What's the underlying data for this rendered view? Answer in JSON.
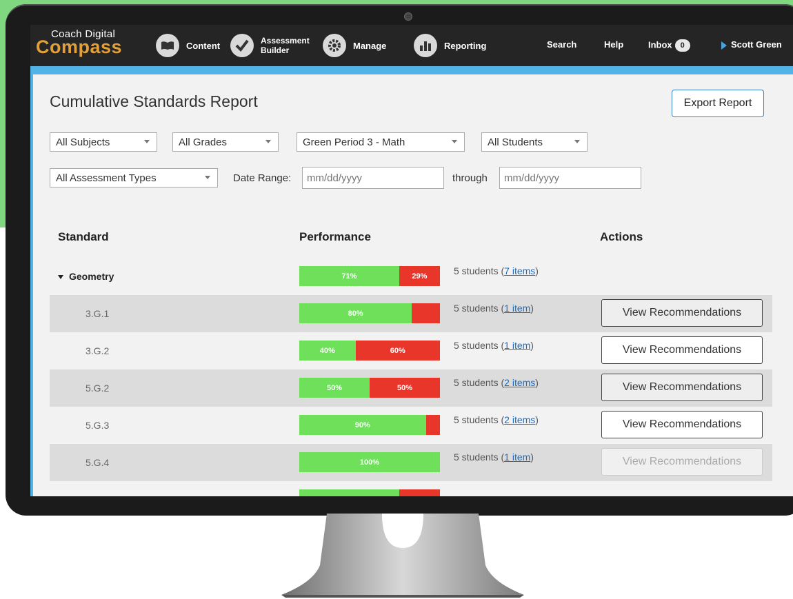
{
  "app": {
    "logo_line1": "Coach Digital",
    "logo_line2": "Compass"
  },
  "nav": {
    "content": "Content",
    "assessment_builder_1": "Assessment",
    "assessment_builder_2": "Builder",
    "manage": "Manage",
    "reporting": "Reporting",
    "search": "Search",
    "help": "Help",
    "inbox": "Inbox",
    "inbox_count": "0",
    "user": "Scott Green"
  },
  "report": {
    "title": "Cumulative Standards Report",
    "export_label": "Export Report"
  },
  "filters": {
    "subjects": "All Subjects",
    "grades": "All Grades",
    "class": "Green Period 3 - Math",
    "students": "All Students",
    "assessment_types": "All Assessment Types",
    "date_range_label": "Date Range:",
    "date_from_placeholder": "mm/dd/yyyy",
    "through_label": "through",
    "date_to_placeholder": "mm/dd/yyyy"
  },
  "table": {
    "headers": {
      "standard": "Standard",
      "performance": "Performance",
      "actions": "Actions"
    },
    "group": {
      "name": "Geometry",
      "green_pct": 71,
      "green_label": "71%",
      "red_pct": 29,
      "red_label": "29%",
      "students_prefix": "5 students (",
      "items_link": "7 items",
      "students_suffix": ")"
    },
    "rows": [
      {
        "standard": "3.G.1",
        "green_pct": 80,
        "green_label": "80%",
        "red_label": "",
        "students_prefix": "5 students (",
        "items_link": "1 item",
        "students_suffix": ")",
        "action": "View Recommendations",
        "action_state": "enabled"
      },
      {
        "standard": "3.G.2",
        "green_pct": 40,
        "green_label": "40%",
        "red_label": "60%",
        "students_prefix": "5 students (",
        "items_link": "1 item",
        "students_suffix": ")",
        "action": "View Recommendations",
        "action_state": "enabled"
      },
      {
        "standard": "5.G.2",
        "green_pct": 50,
        "green_label": "50%",
        "red_label": "50%",
        "students_prefix": "5 students (",
        "items_link": "2 items",
        "students_suffix": ")",
        "action": "View Recommendations",
        "action_state": "enabled"
      },
      {
        "standard": "5.G.3",
        "green_pct": 90,
        "green_label": "90%",
        "red_label": "",
        "students_prefix": "5 students (",
        "items_link": "2 items",
        "students_suffix": ")",
        "action": "View Recommendations",
        "action_state": "enabled"
      },
      {
        "standard": "5.G.4",
        "green_pct": 100,
        "green_label": "100%",
        "red_label": "",
        "students_prefix": "5 students (",
        "items_link": "1 item",
        "students_suffix": ")",
        "action": "View Recommendations",
        "action_state": "disabled"
      }
    ],
    "partial_row": {
      "green_pct": 71
    }
  },
  "colors": {
    "background_green": "#7fd77f",
    "screen_blue": "#53b3e6",
    "nav_dark": "#252525",
    "logo_orange": "#e2a03a",
    "bar_green": "#6ee05a",
    "bar_red": "#e8362b",
    "link_blue": "#1a6cc7"
  }
}
